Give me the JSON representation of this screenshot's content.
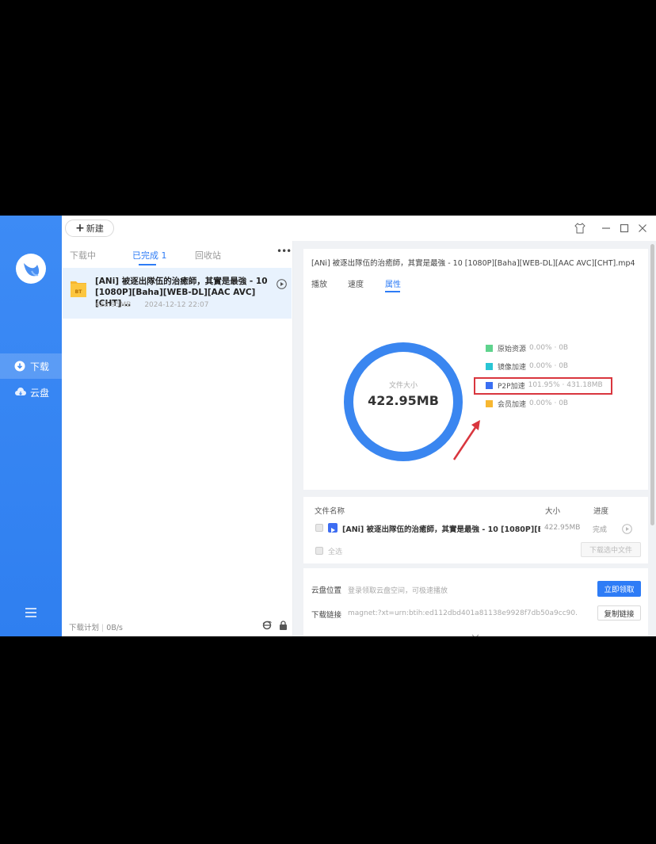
{
  "toolbar": {
    "new_label": "新建"
  },
  "sidebar": {
    "items": [
      {
        "label": "下载",
        "icon": "download-icon",
        "active": true
      },
      {
        "label": "云盘",
        "icon": "cloud-icon",
        "active": false
      }
    ]
  },
  "list": {
    "tabs": [
      {
        "label": "下载中"
      },
      {
        "label": "已完成 1"
      },
      {
        "label": "回收站"
      }
    ],
    "more_label": "•••",
    "task": {
      "badge": "BT",
      "title": "[ANi] 被逐出隊伍的治癒師，其實是最強 - 10 [1080P][Baha][WEB-DL][AAC AVC][CHT]...",
      "size": "422.95MB",
      "date": "2024-12-12 22:07"
    },
    "plan": {
      "label": "下载计划",
      "speed": "0B/s"
    }
  },
  "detail": {
    "file_name": "[ANi] 被逐出隊伍的治癒師，其實是最強 - 10 [1080P][Baha][WEB-DL][AAC AVC][CHT].mp4",
    "tabs": [
      {
        "label": "播放"
      },
      {
        "label": "速度"
      },
      {
        "label": "属性"
      }
    ],
    "donut": {
      "label": "文件大小",
      "value": "422.95MB",
      "color": "#3a86f0"
    },
    "legend": [
      {
        "name": "原始资源",
        "value": "0.00% · 0B",
        "color": "#5fd38d"
      },
      {
        "name": "镜像加速",
        "value": "0.00% · 0B",
        "color": "#29c5d4"
      },
      {
        "name": "P2P加速",
        "value": "101.95% · 431.18MB",
        "color": "#3a6ff2"
      },
      {
        "name": "会员加速",
        "value": "0.00% · 0B",
        "color": "#f7b731"
      }
    ],
    "files": {
      "headers": {
        "name": "文件名称",
        "size": "大小",
        "progress": "进度"
      },
      "row": {
        "name": "[ANi] 被逐出隊伍的治癒師，其實是最強 - 10 [1080P][B...",
        "size": "422.95MB",
        "status": "完成"
      },
      "select_all": "全选",
      "download_selected": "下载选中文件"
    },
    "cloud": {
      "label": "云盘位置",
      "hint": "登录领取云盘空间，可极速播放",
      "claim_button": "立即领取"
    },
    "link": {
      "label": "下载链接",
      "value": "magnet:?xt=urn:btih:ed112dbd401a81138e9928f7db50a9cc90...",
      "copy_button": "复制链接"
    }
  }
}
